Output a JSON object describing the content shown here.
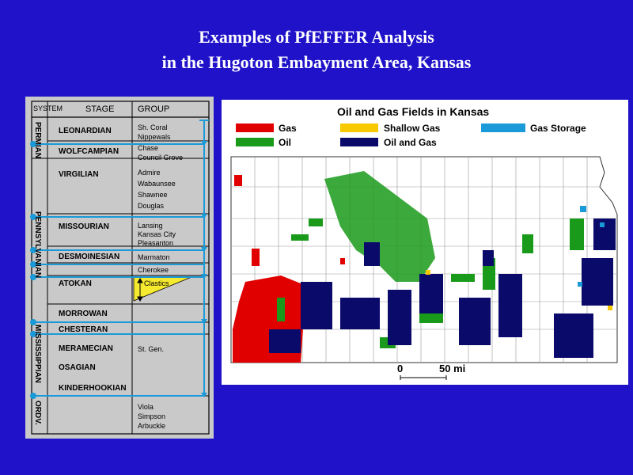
{
  "title": {
    "line1": "Examples of PfEFFER Analysis",
    "line2": "in the Hugoton Embayment Area, Kansas"
  },
  "strat": {
    "headers": {
      "system": "SYSTEM",
      "stage": "STAGE",
      "group": "GROUP"
    },
    "systems": [
      "PERMIAN",
      "PENNSYLVANIAN",
      "MISSISSIPPIAN",
      "ORDV."
    ],
    "stages": [
      "LEONARDIAN",
      "WOLFCAMPIAN",
      "VIRGILIAN",
      "MISSOURIAN",
      "DESMOINESIAN",
      "ATOKAN",
      "MORROWAN",
      "CHESTERAN",
      "MERAMECIAN",
      "OSAGIAN",
      "KINDERHOOKIAN"
    ],
    "groups": [
      "Sh. Coral",
      "Nippewals",
      "Chase",
      "Council Grove",
      "Admire",
      "Wabaunsee",
      "Shawnee",
      "Douglas",
      "Lansing",
      "Kansas City",
      "Pleasanton",
      "Marmaton",
      "Cherokee",
      "Clastics",
      "St. Gen.",
      "Viola",
      "Simpson",
      "Arbuckle"
    ],
    "colors": {
      "background": "#c9c9c9",
      "lines": "#1a9ad8",
      "clastics": "#f5ea30"
    }
  },
  "map": {
    "title": "Oil and Gas Fields in Kansas",
    "legend": [
      {
        "label": "Gas",
        "color": "#e00000"
      },
      {
        "label": "Shallow Gas",
        "color": "#f8c800"
      },
      {
        "label": "Gas Storage",
        "color": "#1a9ad8"
      },
      {
        "label": "Oil",
        "color": "#1a9a1a"
      },
      {
        "label": "Oil and Gas",
        "color": "#0a0a6a"
      }
    ],
    "scale": {
      "zero": "0",
      "distance": "50 mi"
    }
  }
}
